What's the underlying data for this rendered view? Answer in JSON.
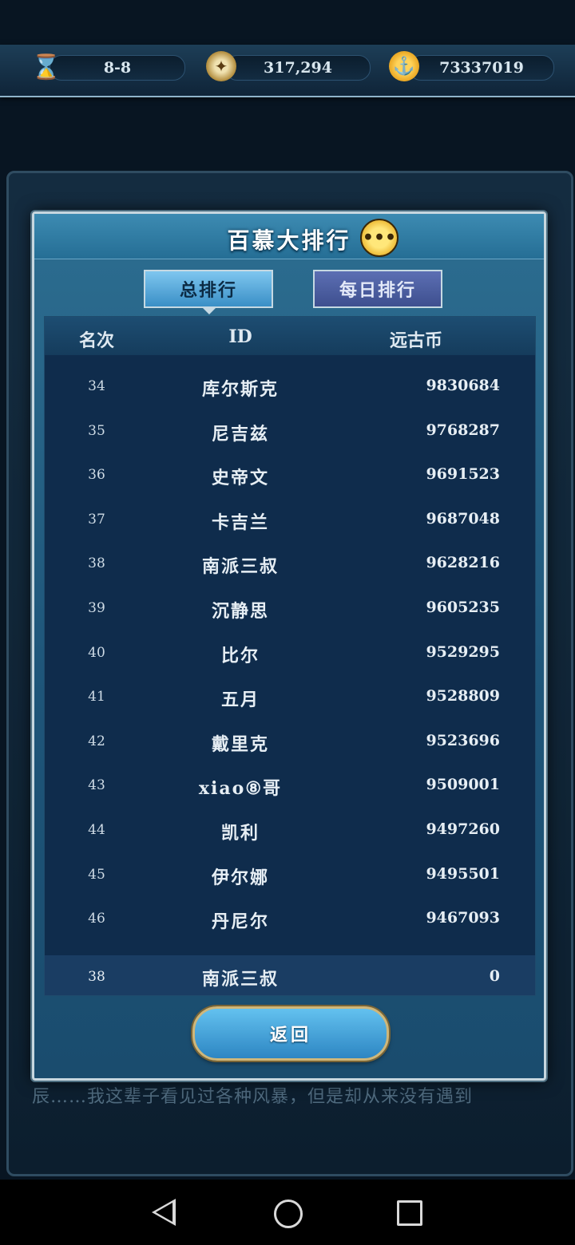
{
  "resources": {
    "stage": "8-8",
    "compass_value": "317,294",
    "coin_value": "73337019"
  },
  "background_text": {
    "line1": "辰……我这辈子看见过各种风暴，但是却从来没有遇到"
  },
  "dialog": {
    "title": "百慕大排行",
    "chat_icon_glyph": "•••",
    "tabs": [
      {
        "label": "总排行",
        "active": true
      },
      {
        "label": "每日排行",
        "active": false
      }
    ],
    "table": {
      "headers": {
        "rank": "名次",
        "id": "ID",
        "coins": "远古币"
      },
      "rows": [
        {
          "rank": "34",
          "id": "库尔斯克",
          "coins": "9830684"
        },
        {
          "rank": "35",
          "id": "尼吉兹",
          "coins": "9768287"
        },
        {
          "rank": "36",
          "id": "史帝文",
          "coins": "9691523"
        },
        {
          "rank": "37",
          "id": "卡吉兰",
          "coins": "9687048"
        },
        {
          "rank": "38",
          "id": "南派三叔",
          "coins": "9628216"
        },
        {
          "rank": "39",
          "id": "沉静思",
          "coins": "9605235"
        },
        {
          "rank": "40",
          "id": "比尔",
          "coins": "9529295"
        },
        {
          "rank": "41",
          "id": "五月",
          "coins": "9528809"
        },
        {
          "rank": "42",
          "id": "戴里克",
          "coins": "9523696"
        },
        {
          "rank": "43",
          "id": "xiao⑧哥",
          "coins": "9509001"
        },
        {
          "rank": "44",
          "id": "凯利",
          "coins": "9497260"
        },
        {
          "rank": "45",
          "id": "伊尔娜",
          "coins": "9495501"
        },
        {
          "rank": "46",
          "id": "丹尼尔",
          "coins": "9467093"
        }
      ],
      "my_row": {
        "rank": "38",
        "id": "南派三叔",
        "coins": "0"
      }
    },
    "back_label": "返回"
  },
  "icons": {
    "hourglass": "hourglass-icon",
    "compass": "compass-icon",
    "coin": "anchor-coin-icon",
    "chat": "chat-bubble-icon"
  },
  "colors": {
    "dialog_bg": "#1e5579",
    "table_bg": "#0f2c4c",
    "active_tab": "#3a8fc6",
    "inactive_tab": "#3e4f8f",
    "gold": "#e6a91b"
  }
}
